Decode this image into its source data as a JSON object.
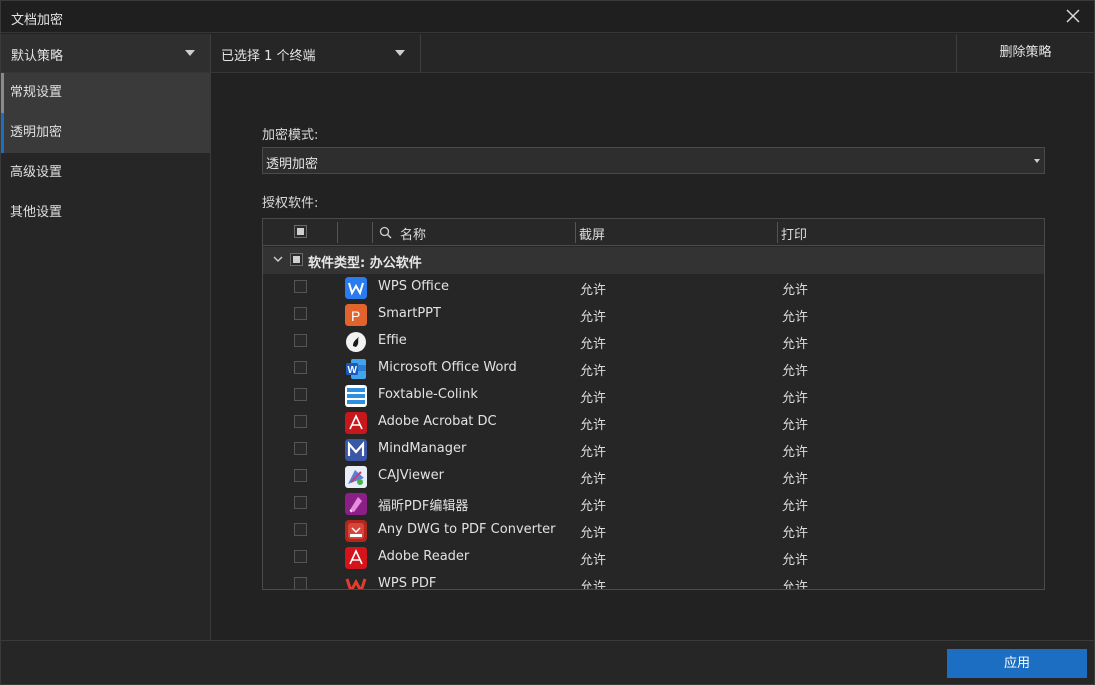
{
  "window": {
    "title": "文档加密"
  },
  "toolbar": {
    "policy": "默认策略",
    "terminals": "已选择 1 个终端",
    "delete_label": "删除策略"
  },
  "sidebar": {
    "items": [
      {
        "label": "常规设置",
        "state": "highlight",
        "bar_color": "#8a8a8a"
      },
      {
        "label": "透明加密",
        "state": "selected",
        "bar_color": "#1b6ec2"
      },
      {
        "label": "高级设置"
      },
      {
        "label": "其他设置"
      }
    ]
  },
  "main": {
    "mode_label": "加密模式:",
    "mode_value": "透明加密",
    "software_label": "授权软件:",
    "table": {
      "columns": {
        "name": "名称",
        "screenshot": "截屏",
        "print": "打印"
      },
      "group": "软件类型: 办公软件",
      "rows": [
        {
          "name": "WPS Office",
          "screenshot": "允许",
          "print": "允许",
          "icon": "wps-office-icon"
        },
        {
          "name": "SmartPPT",
          "screenshot": "允许",
          "print": "允许",
          "icon": "smartppt-icon"
        },
        {
          "name": "Effie",
          "screenshot": "允许",
          "print": "允许",
          "icon": "effie-icon"
        },
        {
          "name": "Microsoft Office Word",
          "screenshot": "允许",
          "print": "允许",
          "icon": "word-icon"
        },
        {
          "name": "Foxtable-Colink",
          "screenshot": "允许",
          "print": "允许",
          "icon": "foxtable-icon"
        },
        {
          "name": "Adobe Acrobat DC",
          "screenshot": "允许",
          "print": "允许",
          "icon": "acrobat-icon"
        },
        {
          "name": "MindManager",
          "screenshot": "允许",
          "print": "允许",
          "icon": "mindmanager-icon"
        },
        {
          "name": "CAJViewer",
          "screenshot": "允许",
          "print": "允许",
          "icon": "cajviewer-icon"
        },
        {
          "name": "福昕PDF编辑器",
          "screenshot": "允许",
          "print": "允许",
          "icon": "foxit-pdf-editor-icon"
        },
        {
          "name": "Any DWG to PDF Converter",
          "screenshot": "允许",
          "print": "允许",
          "icon": "dwg-pdf-icon"
        },
        {
          "name": "Adobe Reader",
          "screenshot": "允许",
          "print": "允许",
          "icon": "adobe-reader-icon"
        },
        {
          "name": "WPS PDF",
          "screenshot": "允许",
          "print": "允许",
          "icon": "wps-pdf-icon"
        }
      ]
    }
  },
  "footer": {
    "apply_label": "应用"
  },
  "colors": {
    "accent": "#1b6ec2",
    "background": "#222222"
  }
}
